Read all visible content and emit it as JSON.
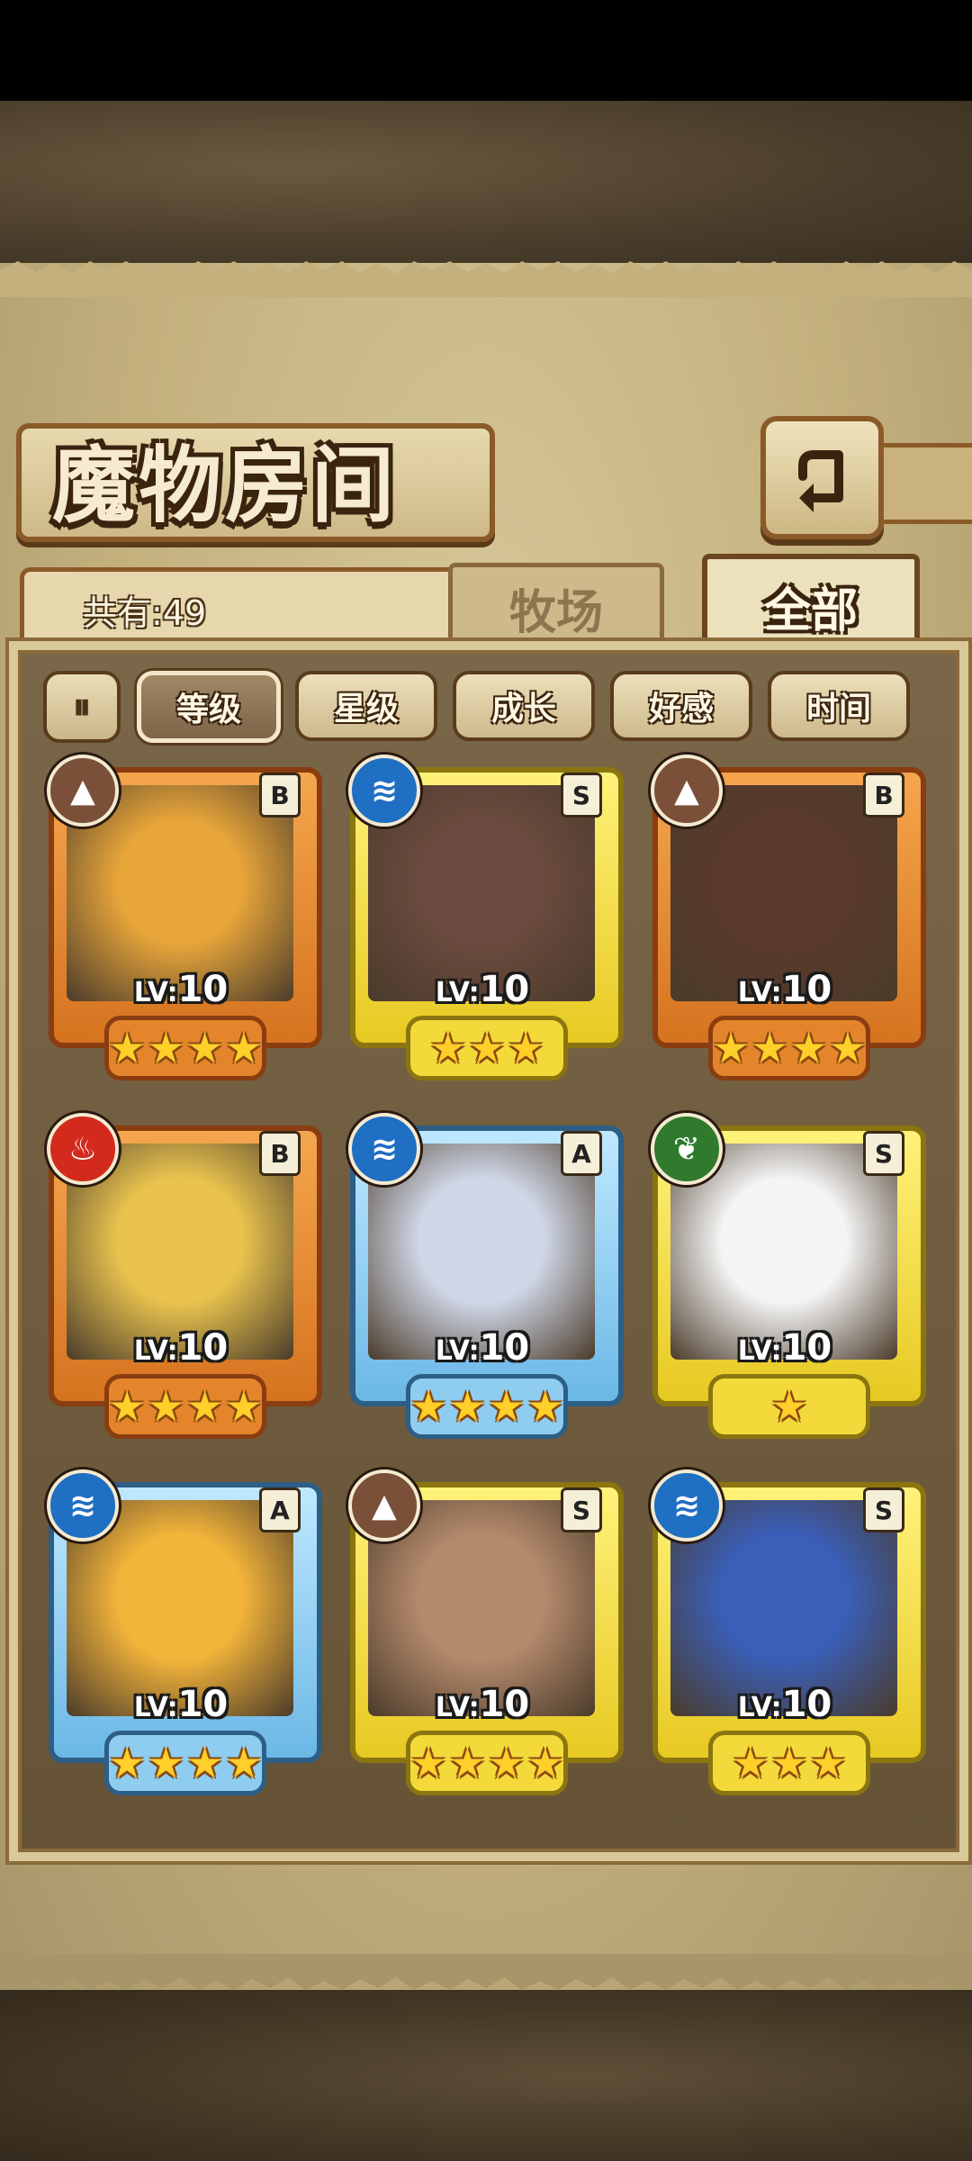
{
  "header": {
    "title": "魔物房间",
    "count_label": "共有:49",
    "back_icon": "back-arrow-icon"
  },
  "tabs": [
    {
      "label": "牧场",
      "active": false
    },
    {
      "label": "全部",
      "active": true
    }
  ],
  "sort": {
    "toggle_icon": "sort-order-icon",
    "buttons": [
      {
        "label": "等级",
        "active": true
      },
      {
        "label": "星级",
        "active": false
      },
      {
        "label": "成长",
        "active": false
      },
      {
        "label": "好感",
        "active": false
      },
      {
        "label": "时间",
        "active": false
      }
    ]
  },
  "monsters": [
    {
      "rank": "B",
      "element": "earth",
      "level_prefix": "LV:",
      "level": "10",
      "stars": 4,
      "art_color": "#e7a53a"
    },
    {
      "rank": "S",
      "element": "water",
      "level_prefix": "LV:",
      "level": "10",
      "stars": 3,
      "art_color": "#6a4a3e"
    },
    {
      "rank": "B",
      "element": "earth",
      "level_prefix": "LV:",
      "level": "10",
      "stars": 4,
      "art_color": "#5a3a2c"
    },
    {
      "rank": "B",
      "element": "fire",
      "level_prefix": "LV:",
      "level": "10",
      "stars": 4,
      "art_color": "#e9c34e"
    },
    {
      "rank": "A",
      "element": "water",
      "level_prefix": "LV:",
      "level": "10",
      "stars": 4,
      "art_color": "#cfd6e6"
    },
    {
      "rank": "S",
      "element": "wood",
      "level_prefix": "LV:",
      "level": "10",
      "stars": 1,
      "art_color": "#f4f4f4"
    },
    {
      "rank": "A",
      "element": "water",
      "level_prefix": "LV:",
      "level": "10",
      "stars": 4,
      "art_color": "#f3b43a"
    },
    {
      "rank": "S",
      "element": "earth",
      "level_prefix": "LV:",
      "level": "10",
      "stars": 4,
      "art_color": "#b48a6c"
    },
    {
      "rank": "S",
      "element": "water",
      "level_prefix": "LV:",
      "level": "10",
      "stars": 3,
      "art_color": "#3a5fb8"
    }
  ],
  "colors": {
    "parchment": "#c3b07d",
    "frame_border": "#8a5a28",
    "panel": "#6f5b3e"
  }
}
